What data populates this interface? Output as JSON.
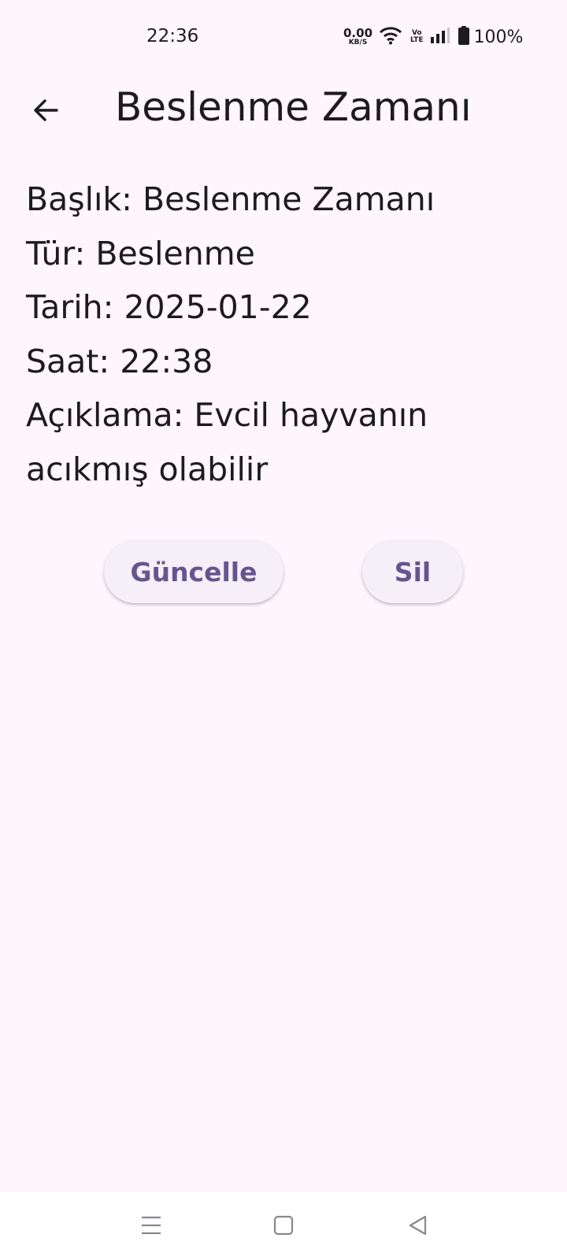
{
  "status_bar": {
    "time": "22:36",
    "net_speed_value": "0.00",
    "net_speed_unit": "KB/S",
    "volte_top": "Vo",
    "volte_bottom": "LTE",
    "battery": "100%"
  },
  "app_bar": {
    "title": "Beslenme Zamanı",
    "back_icon": "arrow-back-icon"
  },
  "details": {
    "title_line": "Başlık: Beslenme Zamanı",
    "type_line": "Tür: Beslenme",
    "date_line": "Tarih: 2025-01-22",
    "time_line": "Saat: 22:38",
    "description_line": "Açıklama: Evcil hayvanın acıkmış olabilir"
  },
  "actions": {
    "update_label": "Güncelle",
    "delete_label": "Sil"
  },
  "nav_bar": {
    "icons": [
      "menu-icon",
      "home-icon",
      "back-triangle-icon"
    ]
  },
  "colors": {
    "background": "#fdf7fd",
    "text": "#1d1b20",
    "accent": "#65558f",
    "button_bg": "#f5f0f7"
  }
}
